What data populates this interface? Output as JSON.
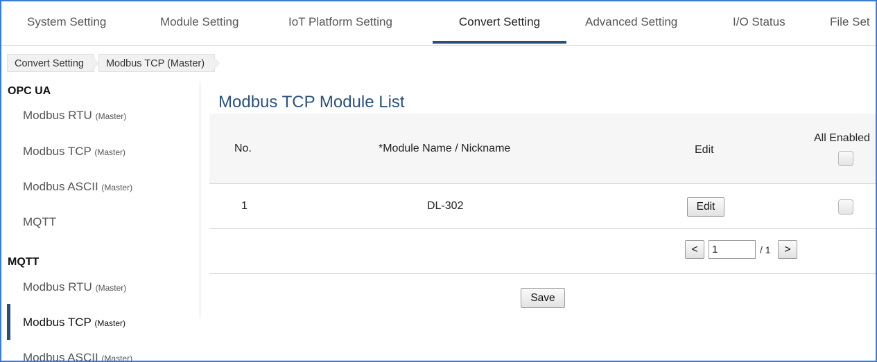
{
  "tabs": [
    {
      "label": "System Setting"
    },
    {
      "label": "Module Setting"
    },
    {
      "label": "IoT Platform Setting"
    },
    {
      "label": "Convert Setting",
      "active": true
    },
    {
      "label": "Advanced Setting"
    },
    {
      "label": "I/O Status"
    },
    {
      "label": "File Set"
    }
  ],
  "breadcrumb": [
    "Convert Setting",
    "Modbus TCP (Master)"
  ],
  "sidebar": {
    "sections": [
      {
        "heading": "OPC UA",
        "items": [
          {
            "label": "Modbus RTU",
            "suffix": "(Master)"
          },
          {
            "label": "Modbus TCP",
            "suffix": "(Master)"
          },
          {
            "label": "Modbus ASCII",
            "suffix": "(Master)"
          },
          {
            "label": "MQTT",
            "suffix": ""
          }
        ]
      },
      {
        "heading": "MQTT",
        "items": [
          {
            "label": "Modbus RTU",
            "suffix": "(Master)"
          },
          {
            "label": "Modbus TCP",
            "suffix": "(Master)",
            "active": true
          },
          {
            "label": "Modbus ASCII",
            "suffix": "(Master)"
          }
        ]
      }
    ]
  },
  "main": {
    "title": "Modbus TCP Module List",
    "columns": {
      "no": "No.",
      "name": "*Module Name / Nickname",
      "edit": "Edit",
      "all_enabled": "All Enabled"
    },
    "rows": [
      {
        "no": "1",
        "name": "DL-302",
        "edit_label": "Edit",
        "enabled": false
      }
    ],
    "all_enabled_checked": false,
    "pager": {
      "prev": "<",
      "current": "1",
      "total": "/ 1",
      "next": ">"
    },
    "save_label": "Save"
  },
  "colors": {
    "accent": "#2a4f7f",
    "title": "#2b527f",
    "frame": "#3a7bd5"
  }
}
